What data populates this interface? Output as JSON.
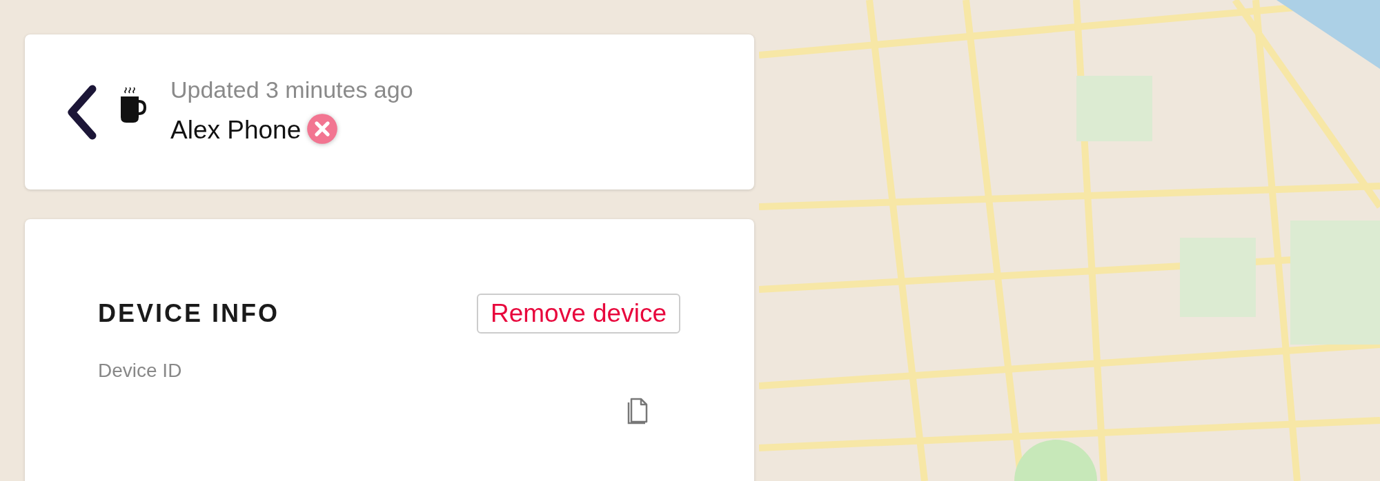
{
  "header": {
    "updated": "Updated 3 minutes ago",
    "device_name": "Alex Phone",
    "online": false
  },
  "device_info": {
    "title": "DEVICE INFO",
    "remove_button": "Remove device",
    "fields": [
      {
        "label": "Device ID"
      }
    ]
  }
}
